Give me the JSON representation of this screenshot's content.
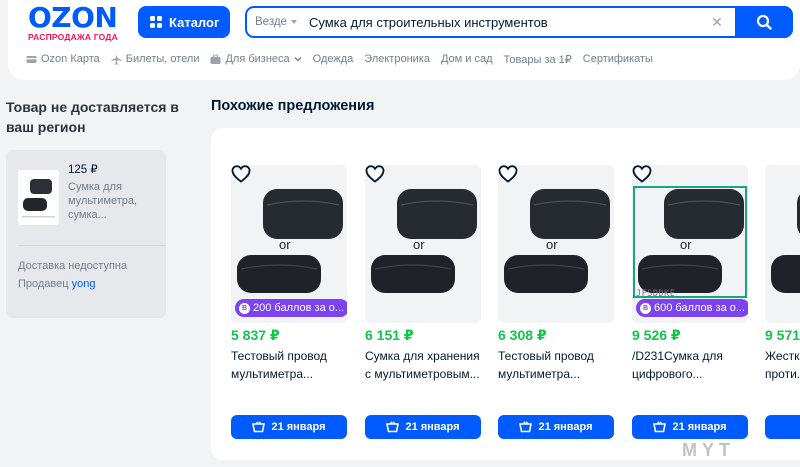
{
  "header": {
    "logo_text": "OZON",
    "logo_sub": "РАСПРОДАЖА ГОДА",
    "catalog_label": "Каталог",
    "search": {
      "scope": "Везде",
      "value": "Сумка для строительных инструментов"
    }
  },
  "nav": [
    {
      "label": "Ozon Карта",
      "icon": "card-icon"
    },
    {
      "label": "Билеты, отели",
      "icon": "plane-icon"
    },
    {
      "label": "Для бизнеса",
      "icon": "briefcase-icon",
      "dropdown": true
    },
    {
      "label": "Одежда"
    },
    {
      "label": "Электроника"
    },
    {
      "label": "Дом и сад"
    },
    {
      "label": "Товары за 1₽"
    },
    {
      "label": "Сертификаты"
    }
  ],
  "sidebar": {
    "title": "Товар не доставляется в ваш регион",
    "price": "125 ₽",
    "name": "Сумка для мультиметра, сумка...",
    "delivery": "Доставка недоступна",
    "seller_label": "Продавец",
    "seller_name": "yong"
  },
  "similar": {
    "title": "Похожие предложения",
    "products": [
      {
        "price": "5 837 ₽",
        "name": "Тестовый провод мультиметра...",
        "bonus": "200 баллов за о...",
        "delivery": "21 января",
        "image_label": "or"
      },
      {
        "price": "6 151 ₽",
        "name": "Сумка для хранения с мультиметровым...",
        "bonus": "",
        "delivery": "21 января",
        "image_label": "or"
      },
      {
        "price": "6 308 ₽",
        "name": "Тестовый провод мультиметра...",
        "bonus": "",
        "delivery": "21 января",
        "image_label": "or"
      },
      {
        "price": "9 526 ₽",
        "name": "/D231Сумка для цифрового...",
        "bonus": "600 баллов за о...",
        "delivery": "21 января",
        "image_label": "or",
        "watermark": "JFSDDKE"
      },
      {
        "price": "9 571",
        "name": "Жестк... проти...",
        "bonus": "",
        "delivery": "",
        "image_label": ""
      }
    ]
  },
  "site_watermark": "MYT",
  "colors": {
    "brand": "#005bff",
    "price": "#10c44c",
    "bonus": "#7b43f1",
    "logo_sub": "#f91155"
  }
}
